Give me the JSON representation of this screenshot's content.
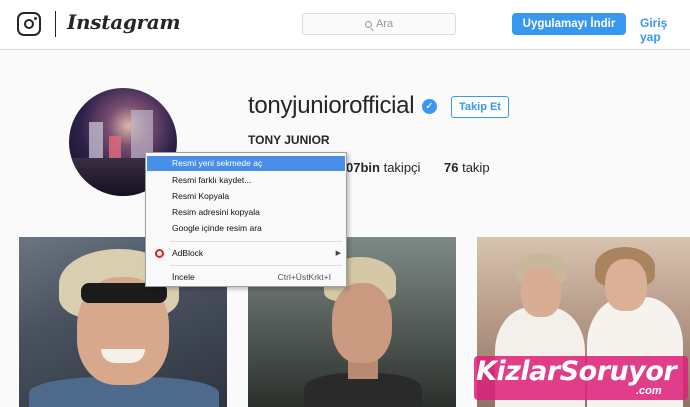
{
  "header": {
    "brand": "Instagram",
    "search_placeholder": "Ara",
    "app_button": "Uygulamayı İndir",
    "login_link": "Giriş yap"
  },
  "profile": {
    "username": "tonyjuniorofficial",
    "verified_mark": "✓",
    "follow_button": "Takip Et",
    "full_name": "TONY JUNIOR",
    "followers_count": "07bin",
    "followers_label": "takipçi",
    "following_count": "76",
    "following_label": "takip"
  },
  "context_menu": {
    "items": [
      "Resmi yeni sekmede aç",
      "Resmi farklı kaydet...",
      "Resmi Kopyala",
      "Resim adresini kopyala",
      "Google içinde resim ara"
    ],
    "adblock": "AdBlock",
    "inspect": "İncele",
    "inspect_shortcut": "Ctrl+ÜstKrkt+I"
  },
  "watermark": {
    "part1": "Kizlar",
    "part2": "S",
    "part3": "oruyor",
    "domain": ".com"
  },
  "colors": {
    "accent": "#3897f0",
    "menu_highlight": "#4a8fe7",
    "opera_red": "#e0201a"
  },
  "icons": {
    "logo": "instagram-camera-icon",
    "search": "search-icon",
    "verified": "verified-badge-icon",
    "adblock": "opera-icon",
    "submenu": "chevron-right-icon"
  }
}
